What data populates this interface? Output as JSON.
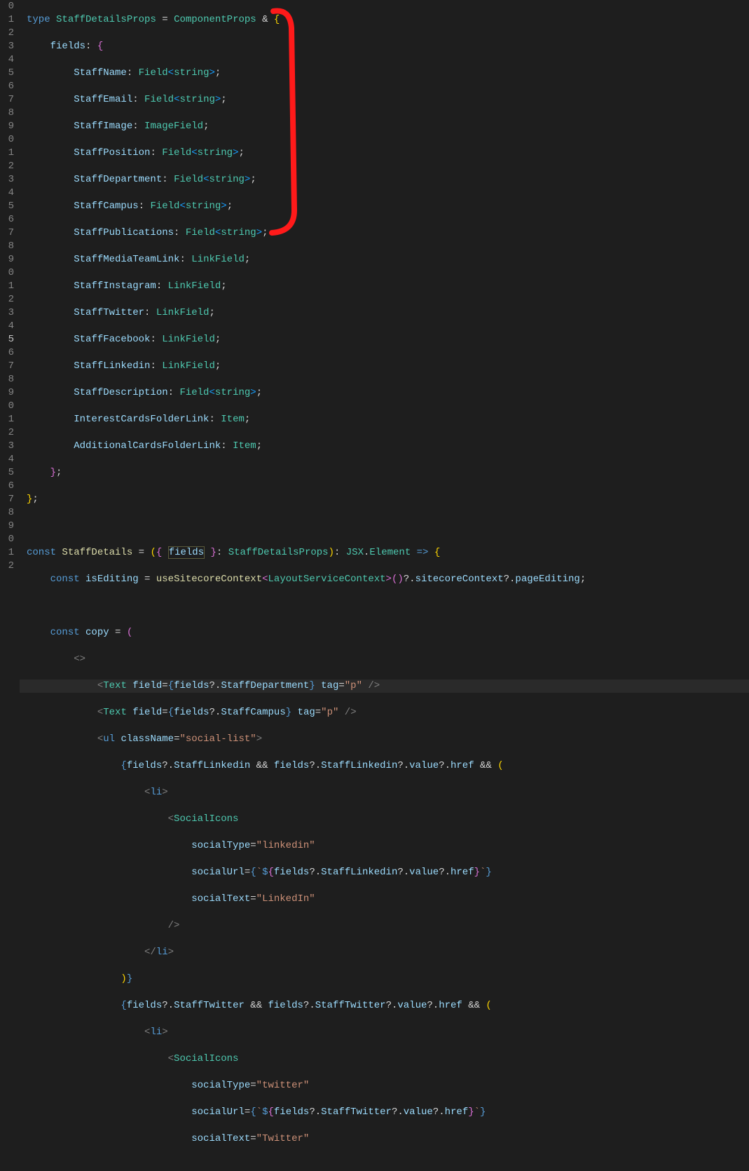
{
  "lineNumbers": [
    "0",
    "1",
    "2",
    "3",
    "4",
    "5",
    "6",
    "7",
    "8",
    "9",
    "0",
    "1",
    "2",
    "3",
    "4",
    "5",
    "6",
    "7",
    "8",
    "9",
    "0",
    "1",
    "2",
    "3",
    "4",
    "5",
    "6",
    "7",
    "8",
    "9",
    "0",
    "1",
    "2",
    "3",
    "4",
    "5",
    "6",
    "7",
    "8",
    "9",
    "0",
    "1",
    "2"
  ],
  "activeLineIndex": 25,
  "code": {
    "l0": {
      "kw": "type",
      "sp": " ",
      "name": "StaffDetailsProps",
      "eq": " = ",
      "base": "ComponentProps",
      "amp": " & ",
      "ob": "{"
    },
    "l1": {
      "indent": "    ",
      "prop": "fields",
      "colon": ": ",
      "ob": "{"
    },
    "l2": {
      "indent": "        ",
      "prop": "StaffName",
      "colon": ": ",
      "gen": "Field",
      "lt": "<",
      "arg": "string",
      "gt": ">",
      ";": ";"
    },
    "l3": {
      "indent": "        ",
      "prop": "StaffEmail",
      "colon": ": ",
      "gen": "Field",
      "lt": "<",
      "arg": "string",
      "gt": ">",
      ";": ";"
    },
    "l4": {
      "indent": "        ",
      "prop": "StaffImage",
      "colon": ": ",
      "type": "ImageField",
      ";": ";"
    },
    "l5": {
      "indent": "        ",
      "prop": "StaffPosition",
      "colon": ": ",
      "gen": "Field",
      "lt": "<",
      "arg": "string",
      "gt": ">",
      ";": ";"
    },
    "l6": {
      "indent": "        ",
      "prop": "StaffDepartment",
      "colon": ": ",
      "gen": "Field",
      "lt": "<",
      "arg": "string",
      "gt": ">",
      ";": ";"
    },
    "l7": {
      "indent": "        ",
      "prop": "StaffCampus",
      "colon": ": ",
      "gen": "Field",
      "lt": "<",
      "arg": "string",
      "gt": ">",
      ";": ";"
    },
    "l8": {
      "indent": "        ",
      "prop": "StaffPublications",
      "colon": ": ",
      "gen": "Field",
      "lt": "<",
      "arg": "string",
      "gt": ">",
      ";": ";"
    },
    "l9": {
      "indent": "        ",
      "prop": "StaffMediaTeamLink",
      "colon": ": ",
      "type": "LinkField",
      ";": ";"
    },
    "l10": {
      "indent": "        ",
      "prop": "StaffInstagram",
      "colon": ": ",
      "type": "LinkField",
      ";": ";"
    },
    "l11": {
      "indent": "        ",
      "prop": "StaffTwitter",
      "colon": ": ",
      "type": "LinkField",
      ";": ";"
    },
    "l12": {
      "indent": "        ",
      "prop": "StaffFacebook",
      "colon": ": ",
      "type": "LinkField",
      ";": ";"
    },
    "l13": {
      "indent": "        ",
      "prop": "StaffLinkedin",
      "colon": ": ",
      "type": "LinkField",
      ";": ";"
    },
    "l14": {
      "indent": "        ",
      "prop": "StaffDescription",
      "colon": ": ",
      "gen": "Field",
      "lt": "<",
      "arg": "string",
      "gt": ">",
      ";": ";"
    },
    "l15": {
      "indent": "        ",
      "prop": "InterestCardsFolderLink",
      "colon": ": ",
      "type": "Item",
      ";": ";"
    },
    "l16": {
      "indent": "        ",
      "prop": "AdditionalCardsFolderLink",
      "colon": ": ",
      "type": "Item",
      ";": ";"
    },
    "l17": {
      "indent": "    ",
      "cb": "}",
      ";": ";"
    },
    "l18": {
      "cb": "}",
      ";": ";"
    },
    "l20": {
      "kw": "const",
      "sp": " ",
      "name": "StaffDetails",
      "eq": " = ",
      "op": "(",
      "ob": "{",
      "sp2": " ",
      "param": "fields",
      "sp3": " ",
      "cb": "}",
      "colon": ": ",
      "ptype": "StaffDetailsProps",
      "cp": ")",
      "colon2": ": ",
      "jsxns": "JSX",
      "dot": ".",
      "elem": "Element",
      "arrow": " => ",
      "ob2": "{"
    },
    "l21": {
      "indent": "    ",
      "kw": "const",
      "sp": " ",
      "name": "isEditing",
      "eq": " = ",
      "fn": "useSitecoreContext",
      "lt": "<",
      "gtype": "LayoutServiceContext",
      "gt": ">",
      "call": "()",
      "q1": "?.",
      "p1": "sitecoreContext",
      "q2": "?.",
      "p2": "pageEditing",
      ";": ";"
    },
    "l23": {
      "indent": "    ",
      "kw": "const",
      "sp": " ",
      "name": "copy",
      "eq": " = ",
      "op": "("
    },
    "l24": {
      "indent": "        ",
      "frag": "<>"
    },
    "l25": {
      "indent": "            ",
      "lt": "<",
      "tag": "Text",
      "sp": " ",
      "a1": "field",
      "eq": "=",
      "ob": "{",
      "v1": "fields",
      "q": "?.",
      "v2": "StaffDepartment",
      "cb": "}",
      "sp2": " ",
      "a2": "tag",
      "eq2": "=",
      "str": "\"p\"",
      "sp3": " ",
      "close": "/>"
    },
    "l26": {
      "indent": "            ",
      "lt": "<",
      "tag": "Text",
      "sp": " ",
      "a1": "field",
      "eq": "=",
      "ob": "{",
      "v1": "fields",
      "q": "?.",
      "v2": "StaffCampus",
      "cb": "}",
      "sp2": " ",
      "a2": "tag",
      "eq2": "=",
      "str": "\"p\"",
      "sp3": " ",
      "close": "/>"
    },
    "l27": {
      "indent": "            ",
      "lt": "<",
      "tag": "ul",
      "sp": " ",
      "a1": "className",
      "eq": "=",
      "str": "\"social-list\"",
      "gt": ">"
    },
    "l28": {
      "indent": "                ",
      "ob": "{",
      "v1": "fields",
      "q1": "?.",
      "v2": "StaffLinkedin",
      "amp": " && ",
      "v3": "fields",
      "q2": "?.",
      "v4": "StaffLinkedin",
      "q3": "?.",
      "v5": "value",
      "q4": "?.",
      "v6": "href",
      "amp2": " && ",
      "op": "("
    },
    "l29": {
      "indent": "                    ",
      "lt": "<",
      "tag": "li",
      "gt": ">"
    },
    "l30": {
      "indent": "                        ",
      "lt": "<",
      "tag": "SocialIcons"
    },
    "l31": {
      "indent": "                            ",
      "attr": "socialType",
      "eq": "=",
      "str": "\"linkedin\""
    },
    "l32": {
      "indent": "                            ",
      "attr": "socialUrl",
      "eq": "=",
      "ob": "{",
      "bt1": "`",
      "dol": "$",
      "ob2": "{",
      "v1": "fields",
      "q1": "?.",
      "v2": "StaffLinkedin",
      "q2": "?.",
      "v3": "value",
      "q3": "?.",
      "v4": "href",
      "cb2": "}",
      "bt2": "`",
      "cb": "}"
    },
    "l33": {
      "indent": "                            ",
      "attr": "socialText",
      "eq": "=",
      "str": "\"LinkedIn\""
    },
    "l34": {
      "indent": "                        ",
      "close": "/>"
    },
    "l35": {
      "indent": "                    ",
      "lt": "</",
      "tag": "li",
      "gt": ">"
    },
    "l36": {
      "indent": "                ",
      "cp": ")",
      "cb": "}"
    },
    "l37": {
      "indent": "                ",
      "ob": "{",
      "v1": "fields",
      "q1": "?.",
      "v2": "StaffTwitter",
      "amp": " && ",
      "v3": "fields",
      "q2": "?.",
      "v4": "StaffTwitter",
      "q3": "?.",
      "v5": "value",
      "q4": "?.",
      "v6": "href",
      "amp2": " && ",
      "op": "("
    },
    "l38": {
      "indent": "                    ",
      "lt": "<",
      "tag": "li",
      "gt": ">"
    },
    "l39": {
      "indent": "                        ",
      "lt": "<",
      "tag": "SocialIcons"
    },
    "l40": {
      "indent": "                            ",
      "attr": "socialType",
      "eq": "=",
      "str": "\"twitter\""
    },
    "l41": {
      "indent": "                            ",
      "attr": "socialUrl",
      "eq": "=",
      "ob": "{",
      "bt1": "`",
      "dol": "$",
      "ob2": "{",
      "v1": "fields",
      "q1": "?.",
      "v2": "StaffTwitter",
      "q2": "?.",
      "v3": "value",
      "q3": "?.",
      "v4": "href",
      "cb2": "}",
      "bt2": "`",
      "cb": "}"
    },
    "l42": {
      "indent": "                            ",
      "attr": "socialText",
      "eq": "=",
      "str": "\"Twitter\""
    }
  },
  "annotation": {
    "color": "#ff1a1a",
    "strokeWidth": 8
  }
}
